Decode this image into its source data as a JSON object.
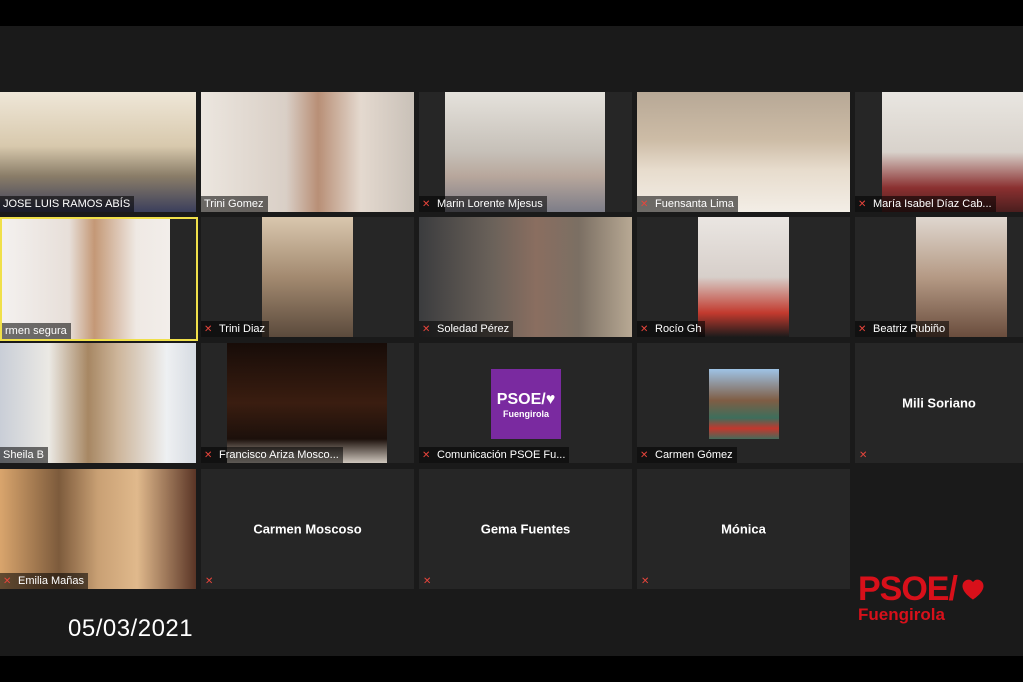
{
  "participants": [
    {
      "name": "JOSE LUIS RAMOS ABÍS",
      "muted": false
    },
    {
      "name": "Trini Gomez",
      "muted": false
    },
    {
      "name": "Marin Lorente Mjesus",
      "muted": true
    },
    {
      "name": "Fuensanta Lima",
      "muted": true
    },
    {
      "name": "María Isabel Díaz Cab...",
      "muted": true
    },
    {
      "name": "rmen segura",
      "muted": false
    },
    {
      "name": "Trini Diaz",
      "muted": true
    },
    {
      "name": "Soledad Pérez",
      "muted": true
    },
    {
      "name": "Rocío Gh",
      "muted": true
    },
    {
      "name": "Beatriz Rubiño",
      "muted": true
    },
    {
      "name": "Sheila B",
      "muted": false
    },
    {
      "name": "Francisco Ariza Mosco...",
      "muted": true
    },
    {
      "name": "Comunicación PSOE Fu...",
      "muted": true
    },
    {
      "name": "Carmen Gómez",
      "muted": true
    },
    {
      "name": "Mili Soriano",
      "muted": true
    },
    {
      "name": "Emilia Mañas",
      "muted": true
    },
    {
      "name": "Carmen Moscoso",
      "muted": true
    },
    {
      "name": "Gema Fuentes",
      "muted": true
    },
    {
      "name": "Mónica",
      "muted": true
    }
  ],
  "comm_badge": {
    "line1": "PSOE/♥",
    "line2": "Fuengirola"
  },
  "date": "05/03/2021",
  "logo": {
    "line1": "PSOE/",
    "line2": "Fuengirola"
  },
  "colors": {
    "accent": "#d8101a",
    "active_border": "#f0e04a",
    "mic_muted": "#e8453c"
  }
}
